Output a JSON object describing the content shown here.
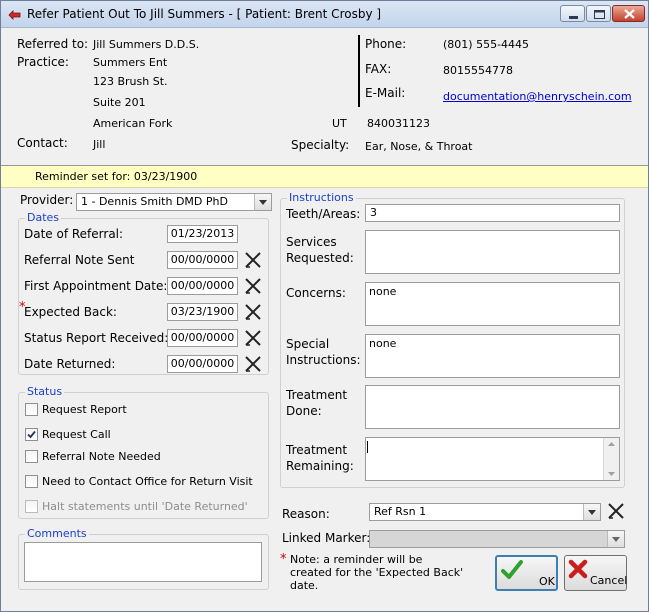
{
  "window": {
    "title": "Refer Patient Out To Jill Summers - [ Patient: Brent Crosby ]"
  },
  "referral": {
    "referred_to_label": "Referred to:",
    "referred_to_value": "Jill Summers  D.D.S.",
    "practice_label": "Practice:",
    "practice_name": "Summers Ent",
    "address1": "123 Brush St.",
    "address2": "Suite 201",
    "city": "American Fork",
    "state": "UT",
    "zip": "840031123",
    "contact_label": "Contact:",
    "contact_value": "Jill",
    "phone_label": "Phone:",
    "phone_value": "(801) 555-4445",
    "fax_label": "FAX:",
    "fax_value": "8015554778",
    "email_label": "E-Mail:",
    "email_value": "documentation@henryschein.com",
    "specialty_label": "Specialty:",
    "specialty_value": "Ear, Nose, & Throat"
  },
  "reminder": {
    "text": "Reminder set for: 03/23/1900"
  },
  "provider": {
    "label": "Provider:",
    "value": "1 - Dennis Smith DMD PhD"
  },
  "dates": {
    "group_title": "Dates",
    "date_of_referral_label": "Date of Referral:",
    "date_of_referral_value": "01/23/2013",
    "referral_note_sent_label": "Referral Note Sent",
    "referral_note_sent_value": "00/00/0000",
    "first_appointment_label": "First Appointment Date:",
    "first_appointment_value": "00/00/0000",
    "expected_back_label": "Expected Back:",
    "expected_back_value": "03/23/1900",
    "status_report_label": "Status Report Received:",
    "status_report_value": "00/00/0000",
    "date_returned_label": "Date Returned:",
    "date_returned_value": "00/00/0000"
  },
  "status": {
    "group_title": "Status",
    "request_report": "Request Report",
    "request_call": "Request Call",
    "referral_note_needed": "Referral Note Needed",
    "need_to_contact": "Need to Contact Office for Return Visit",
    "halt_statements": "Halt statements until 'Date Returned'"
  },
  "comments": {
    "group_title": "Comments",
    "value": ""
  },
  "instructions": {
    "group_title": "Instructions",
    "teeth_areas_label": "Teeth/Areas:",
    "teeth_areas_value": "3",
    "services_requested_label_1": "Services",
    "services_requested_label_2": "Requested:",
    "services_requested_value": "",
    "concerns_label": "Concerns:",
    "concerns_value": "none",
    "special_instructions_label_1": "Special",
    "special_instructions_label_2": "Instructions:",
    "special_instructions_value": "none",
    "treatment_done_label_1": "Treatment",
    "treatment_done_label_2": "Done:",
    "treatment_done_value": "",
    "treatment_remaining_label_1": "Treatment",
    "treatment_remaining_label_2": "Remaining:",
    "treatment_remaining_value": ""
  },
  "reason": {
    "label": "Reason:",
    "value": "Ref Rsn 1"
  },
  "linked_marker": {
    "label": "Linked Marker:",
    "value": ""
  },
  "note": {
    "asterisk": "*",
    "line1": "Note: a reminder will be",
    "line2": "created for the 'Expected Back'",
    "line3": "date."
  },
  "buttons": {
    "ok": "OK",
    "cancel": "Cancel"
  },
  "colors": {
    "accent": "#1c3ec9",
    "reminder_bg": "#ffffc4",
    "required": "#cc0000"
  }
}
